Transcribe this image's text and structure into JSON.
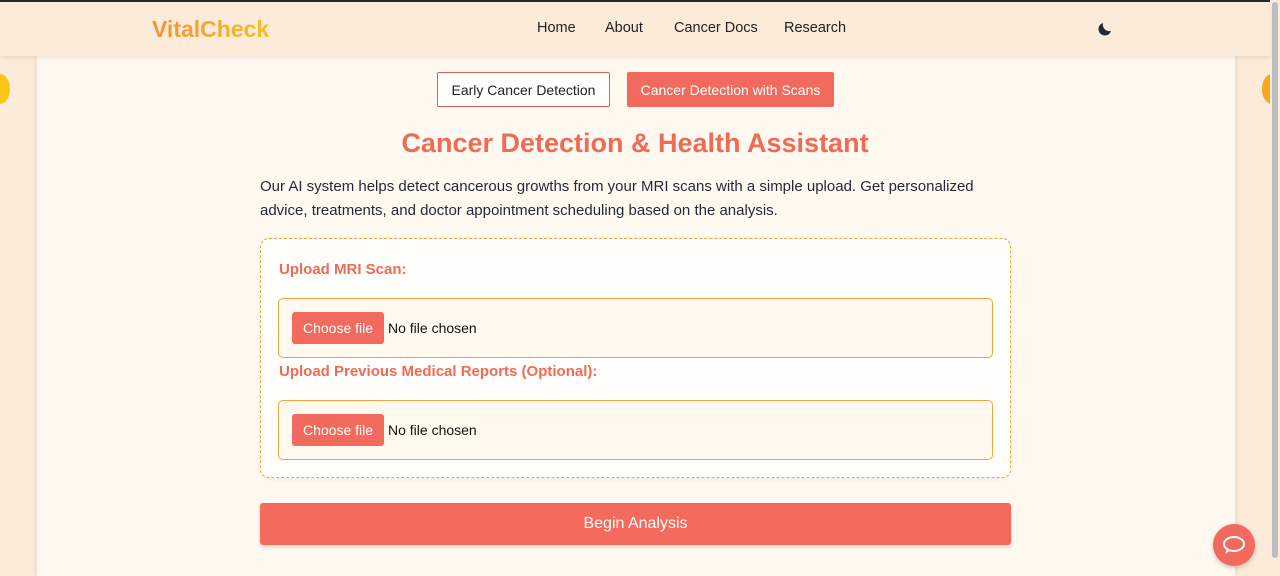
{
  "brand": "VitalCheck",
  "nav": {
    "home": "Home",
    "about": "About",
    "docs": "Cancer Docs",
    "research": "Research"
  },
  "theme_toggle_icon": "moon-icon",
  "tabs": {
    "early": "Early Cancer Detection",
    "scans": "Cancer Detection with Scans",
    "active": "scans"
  },
  "main": {
    "title": "Cancer Detection & Health Assistant",
    "description": "Our AI system helps detect cancerous growths from your MRI scans with a simple upload. Get personalized advice, treatments, and doctor appointment scheduling based on the analysis."
  },
  "upload": {
    "mri_label": "Upload MRI Scan:",
    "mri_button": "Choose file",
    "mri_status": "No file chosen",
    "reports_label": "Upload Previous Medical Reports (Optional):",
    "reports_button": "Choose file",
    "reports_status": "No file chosen"
  },
  "begin_button": "Begin Analysis",
  "chat_icon": "chat-bubble-icon",
  "colors": {
    "accent": "#f26a5d",
    "brand_gradient_start": "#f4913a",
    "brand_gradient_end": "#f5c026",
    "border": "#f0a63a",
    "background": "#fff9ef"
  }
}
